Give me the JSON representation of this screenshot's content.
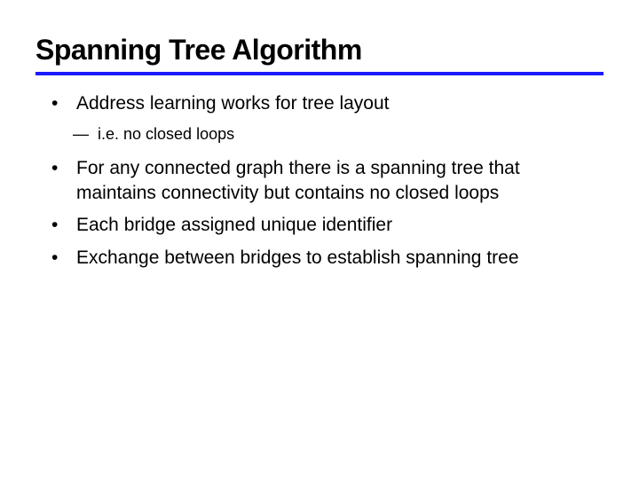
{
  "title": "Spanning Tree Algorithm",
  "bullets": [
    {
      "text": "Address learning works for tree layout",
      "sub": "i.e. no closed loops"
    },
    {
      "text": "For any connected graph there is a spanning tree that maintains connectivity but contains no closed loops"
    },
    {
      "text": "Each bridge assigned unique identifier"
    },
    {
      "text": "Exchange between bridges to establish spanning tree"
    }
  ]
}
